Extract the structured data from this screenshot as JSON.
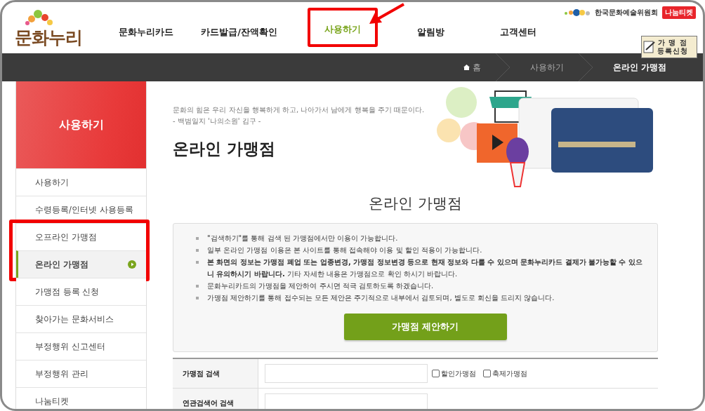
{
  "header": {
    "logo": "문화누리",
    "org": "한국문화예술위원회",
    "badge": "나눔티켓",
    "register_button": [
      "가 맹 점",
      "등록신청"
    ]
  },
  "nav": [
    {
      "label": "문화누리카드",
      "selected": false,
      "annotated": false
    },
    {
      "label": "카드발급/잔액확인",
      "selected": false,
      "annotated": false
    },
    {
      "label": "사용하기",
      "selected": true,
      "annotated": true
    },
    {
      "label": "알림방",
      "selected": false,
      "annotated": false
    },
    {
      "label": "고객센터",
      "selected": false,
      "annotated": false
    }
  ],
  "breadcrumb": [
    "홈",
    "사용하기",
    "온라인 가맹점"
  ],
  "sidebar": {
    "title": "사용하기",
    "items": [
      {
        "label": "사용하기",
        "selected": false,
        "annotated": false
      },
      {
        "label": "수령등록/인터넷 사용등록",
        "selected": false,
        "annotated": false
      },
      {
        "label": "오프라인 가맹점",
        "selected": false,
        "annotated": true
      },
      {
        "label": "온라인 가맹점",
        "selected": true,
        "annotated": true
      },
      {
        "label": "가맹점 등록 신청",
        "selected": false,
        "annotated": false
      },
      {
        "label": "찾아가는 문화서비스",
        "selected": false,
        "annotated": false
      },
      {
        "label": "부정행위 신고센터",
        "selected": false,
        "annotated": false
      },
      {
        "label": "부정행위 관리",
        "selected": false,
        "annotated": false
      },
      {
        "label": "나눔티켓",
        "selected": false,
        "annotated": false
      }
    ]
  },
  "quote": [
    "문화의 힘은 우리 자신을 행복하게 하고, 나아가서 남에게 행복을 주기 때문이다.",
    "- 백범일지 '나의소원' 김구 -"
  ],
  "page_title": "온라인 가맹점",
  "section_title": "온라인 가맹점",
  "notices": [
    "\"검색하기\"를 통해 검색 된 가맹점에서만 이용이 가능합니다.",
    "일부 온라인 가맹점 이용은 본 사이트를 통해 접속해야 이용 및 할인 적용이 가능합니다.",
    "**본 화면의 정보는 가맹점 폐업 또는 업종변경, 가맹점 정보변경 등으로 현재 정보와 다를 수 있으며 문화누리카드 결제가 불가능할 수 있으니 유의하시기 바랍니다.** 기타 자세한 내용은 가맹점으로 확인 하시기 바랍니다.",
    "문화누리카드의 가맹점을 제안하여 주시면 적극 검토하도록 하겠습니다.",
    "가맹점 제안하기를 통해 접수되는 모든 제안은 주기적으로 내부에서 검토되며, 별도로 회신을 드리지 않습니다."
  ],
  "suggest_button": "가맹점 제안하기",
  "search_rows": [
    {
      "label": "가맹점 검색",
      "options": [
        {
          "label": "할인가맹점",
          "checked": false
        },
        {
          "label": "축제가맹점",
          "checked": false
        }
      ]
    },
    {
      "label": "연관검색어 검색",
      "options": []
    }
  ]
}
